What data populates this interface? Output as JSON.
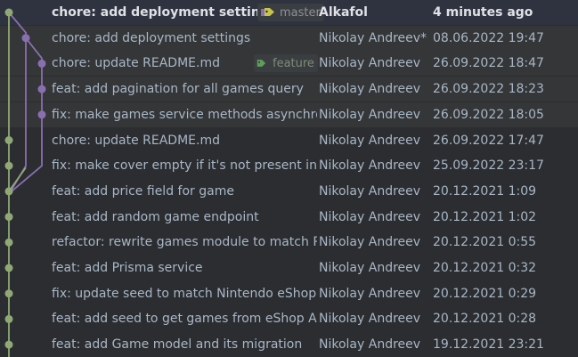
{
  "commits": [
    {
      "subject": "chore: add deployment settings",
      "author": "Alkafol",
      "date": "4 minutes ago",
      "ref": "master",
      "head": true
    },
    {
      "subject": "chore: add deployment settings",
      "author": "Nikolay Andreev*",
      "date": "08.06.2022 19:47"
    },
    {
      "subject": "chore: update README.md",
      "author": "Nikolay Andreev",
      "date": "26.09.2022 18:47",
      "ref": "feature"
    },
    {
      "subject": "feat: add pagination for all games query",
      "author": "Nikolay Andreev",
      "date": "26.09.2022 18:23"
    },
    {
      "subject": "fix: make games service methods asynchronous",
      "author": "Nikolay Andreev",
      "date": "26.09.2022 18:05"
    },
    {
      "subject": "chore: update README.md",
      "author": "Nikolay Andreev",
      "date": "26.09.2022 17:47"
    },
    {
      "subject": "fix: make cover empty if it's not present in eShop",
      "author": "Nikolay Andreev",
      "date": "25.09.2022 23:17"
    },
    {
      "subject": "feat: add price field for game",
      "author": "Nikolay Andreev",
      "date": "20.12.2021 1:09"
    },
    {
      "subject": "feat: add random game endpoint",
      "author": "Nikolay Andreev",
      "date": "20.12.2021 1:02"
    },
    {
      "subject": "refactor: rewrite games module to match Prisma",
      "author": "Nikolay Andreev",
      "date": "20.12.2021 0:55"
    },
    {
      "subject": "feat: add Prisma service",
      "author": "Nikolay Andreev",
      "date": "20.12.2021 0:32"
    },
    {
      "subject": "fix: update seed to match Nintendo eShop API",
      "author": "Nikolay Andreev",
      "date": "20.12.2021 0:29"
    },
    {
      "subject": "feat: add seed to get games from eShop API",
      "author": "Nikolay Andreev",
      "date": "20.12.2021 0:28"
    },
    {
      "subject": "feat: add Game model and its migration",
      "author": "Nikolay Andreev",
      "date": "19.12.2021 23:21"
    }
  ],
  "colors": {
    "lane_main": "#8fa876",
    "lane_branch": "#8a6fb0",
    "tag_master": "#c8c44a",
    "tag_feature": "#5f9e5a"
  }
}
